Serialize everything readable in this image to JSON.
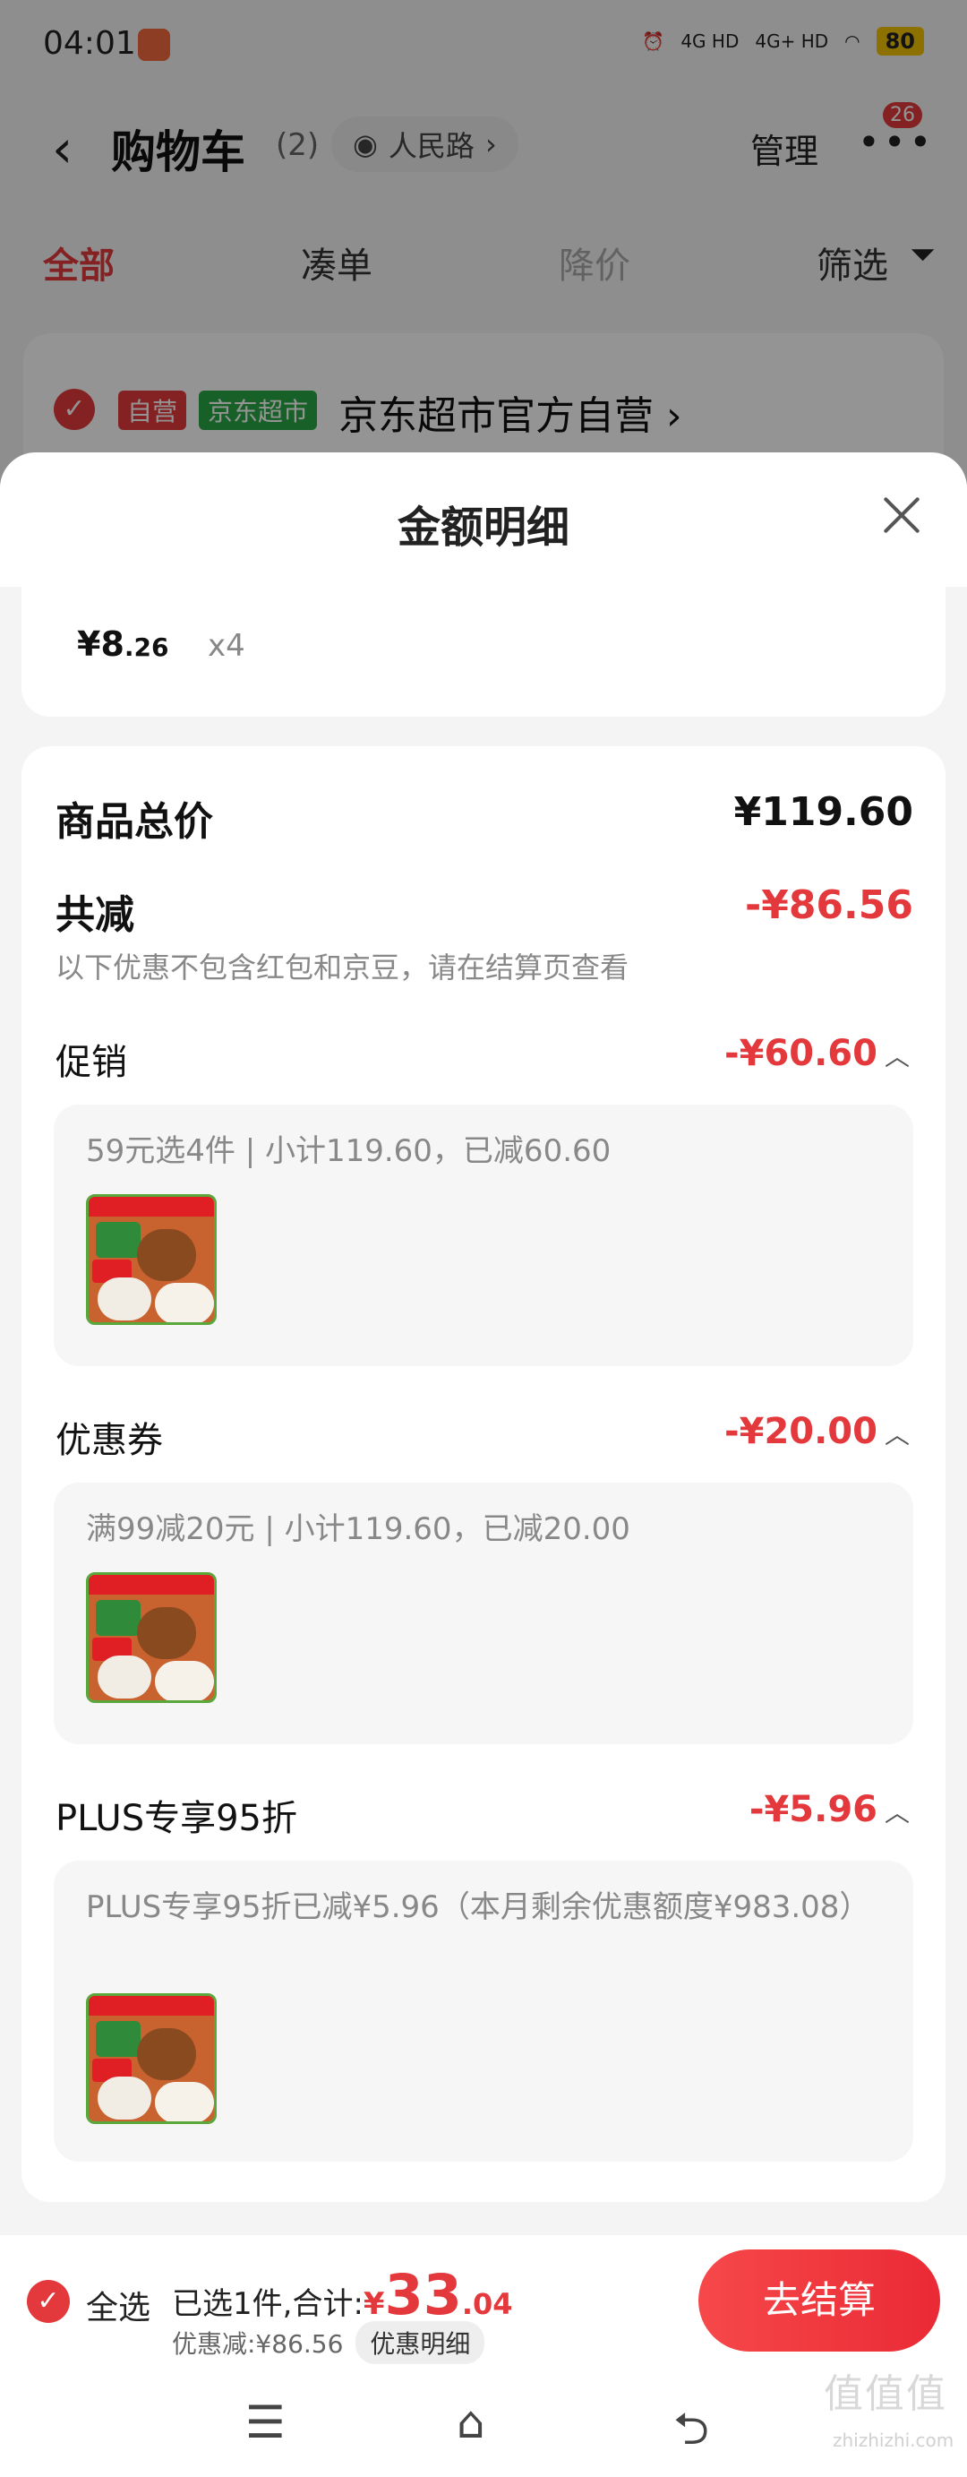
{
  "status_bar": {
    "time": "04:01",
    "network_1": "4G HD",
    "network_2": "4G+ HD",
    "battery": "80"
  },
  "header": {
    "back_icon": "chevron-left-icon",
    "title": "购物车",
    "count": "(2)",
    "location": "人民路",
    "manage": "管理",
    "more_badge": "26"
  },
  "tabs": [
    {
      "label": "全部",
      "active": true
    },
    {
      "label": "凑单",
      "active": false
    },
    {
      "label": "降价",
      "active": false
    },
    {
      "label": "筛选",
      "active": false
    }
  ],
  "shop": {
    "tag_self": "自营",
    "tag_market": "京东超市",
    "name": "京东超市官方自营 ›"
  },
  "sheet": {
    "title": "金额明细",
    "item": {
      "price_int": "¥8",
      "price_dec": ".26",
      "qty": "x4"
    },
    "goods_total": {
      "label": "商品总价",
      "value": "¥119.60"
    },
    "total_discount": {
      "label": "共减",
      "value": "-¥86.56",
      "note": "以下优惠不包含红包和京豆，请在结算页查看"
    },
    "sections": [
      {
        "label": "促销",
        "value": "-¥60.60",
        "detail": "59元选4件 | 小计119.60，已减60.60"
      },
      {
        "label": "优惠券",
        "value": "-¥20.00",
        "detail": "满99减20元 | 小计119.60，已减20.00"
      },
      {
        "label": "PLUS专享95折",
        "value": "-¥5.96",
        "detail": "PLUS专享95折已减¥5.96（本月剩余优惠额度¥983.08）"
      }
    ]
  },
  "bottom_bar": {
    "select_all": "全选",
    "selected_summary": "已选1件,合计:",
    "total_currency": "¥",
    "total_int": "33",
    "total_dec": ".04",
    "discount_text": "优惠减:¥86.56",
    "detail_button": "优惠明细",
    "checkout": "去结算"
  },
  "watermark": {
    "main": "值值值",
    "sub": "zhizhizhi.com"
  },
  "colors": {
    "accent": "#e4393c",
    "market_green": "#28a846"
  }
}
